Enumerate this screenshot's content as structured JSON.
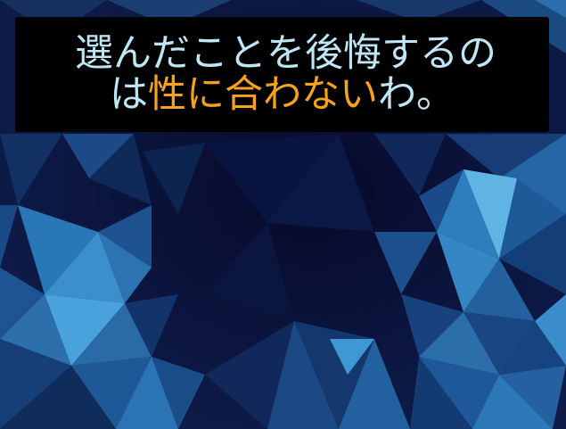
{
  "caption": {
    "line1": "選んだことを後悔するの",
    "line2_prefix": "は",
    "line2_highlight": "性に合わない",
    "line2_suffix": "わ。"
  },
  "colors": {
    "caption_background": "#000000",
    "caption_text": "#bfe6f5",
    "caption_highlight": "#f6a21a",
    "background_dark": "#0a1030",
    "background_accent": "#3fa0d8"
  },
  "background": {
    "icon": "low-poly-blue-pattern"
  }
}
